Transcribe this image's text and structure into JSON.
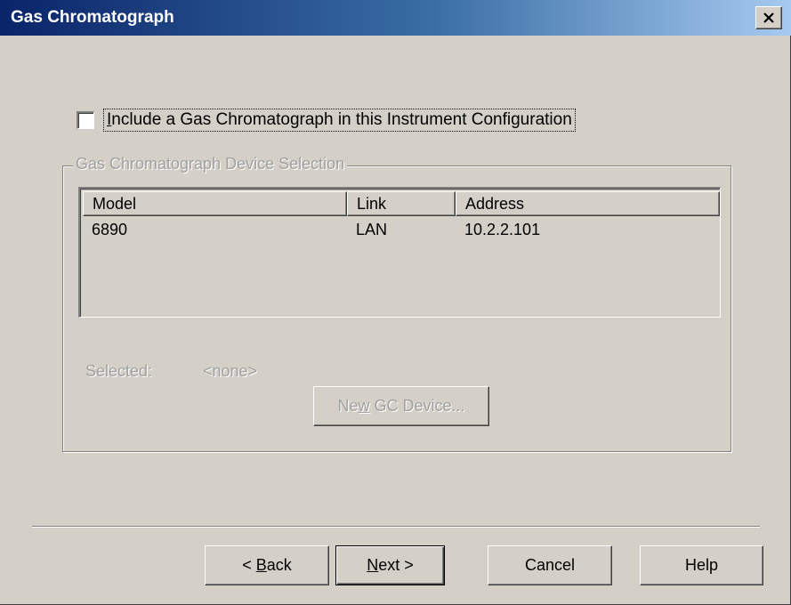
{
  "window": {
    "title": "Gas Chromatograph"
  },
  "include_checkbox": {
    "label_prefix": "",
    "label_mnemonic": "I",
    "label_rest": "nclude a Gas Chromatograph in this Instrument Configuration",
    "checked": false
  },
  "device_selection": {
    "legend": "Gas Chromatograph Device Selection",
    "columns": [
      "Model",
      "Link",
      "Address"
    ],
    "rows": [
      {
        "model": "6890",
        "link": "LAN",
        "address": "10.2.2.101"
      }
    ],
    "selected_label": "Selected:",
    "selected_value": "<none>",
    "new_device_button": {
      "prefix": "Ne",
      "mnemonic": "w",
      "rest": " GC Device..."
    }
  },
  "footer": {
    "back": {
      "prefix": "< ",
      "mnemonic": "B",
      "rest": "ack"
    },
    "next": {
      "prefix": "",
      "mnemonic": "N",
      "rest": "ext >"
    },
    "cancel": "Cancel",
    "help": "Help"
  },
  "colors": {
    "face": "#d4d0c8",
    "title_start": "#0a246a",
    "title_end": "#a6caf0",
    "disabled_text": "#a0a0a0"
  }
}
